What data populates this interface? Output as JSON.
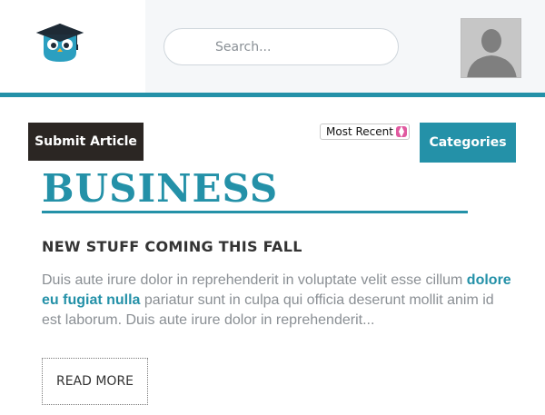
{
  "header": {
    "search_placeholder": "Search..."
  },
  "toolbar": {
    "submit_label": "Submit Article",
    "sort_selected": "Most Recent",
    "categories_label": "Categories"
  },
  "page": {
    "title": "BUSINESS"
  },
  "article": {
    "title": "NEW STUFF COMING THIS FALL",
    "body_start": "Duis aute irure dolor in reprehenderit in voluptate velit esse cillum ",
    "body_link": "dolore eu fugiat nulla",
    "body_end": " pariatur sunt in culpa qui officia deserunt mollit anim id est laborum. Duis aute irure dolor in reprehenderit...",
    "read_more_label": "READ MORE"
  },
  "colors": {
    "accent": "#2491a8",
    "dark_button": "#2b2623",
    "body_text": "#8a8f94"
  },
  "icons": {
    "logo": "owl-graduation-cap-icon",
    "avatar": "user-silhouette-icon",
    "sort_arrows": "select-arrows-icon"
  }
}
